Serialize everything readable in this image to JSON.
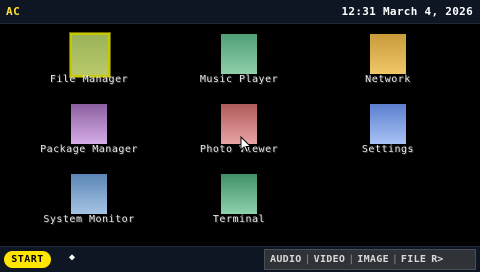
{
  "header": {
    "brand": "AC",
    "clock": "12:31 March 4, 2026"
  },
  "apps": [
    {
      "label": "File Manager",
      "icon": "file-manager-icon",
      "color_top": "#9bb35a",
      "color_bottom": "#b8c96a",
      "selected": true
    },
    {
      "label": "Music Player",
      "icon": "music-player-icon",
      "color_top": "#4f9f77",
      "color_bottom": "#8fd0aa"
    },
    {
      "label": "Network",
      "icon": "network-icon",
      "color_top": "#c99a3a",
      "color_bottom": "#f0c768"
    },
    {
      "label": "Package Manager",
      "icon": "package-manager-icon",
      "color_top": "#8a5fa0",
      "color_bottom": "#d6aee8"
    },
    {
      "label": "Photo Viewer",
      "icon": "photo-viewer-icon",
      "color_top": "#b05a5a",
      "color_bottom": "#e8a4a4"
    },
    {
      "label": "Settings",
      "icon": "settings-icon",
      "color_top": "#5c7fcf",
      "color_bottom": "#a9c2f4"
    },
    {
      "label": "System Monitor",
      "icon": "system-monitor-icon",
      "color_top": "#5b86b5",
      "color_bottom": "#a6c4e4"
    },
    {
      "label": "Terminal",
      "icon": "terminal-icon",
      "color_top": "#3f9068",
      "color_bottom": "#8fd2ad"
    }
  ],
  "footer": {
    "start_label": "START",
    "marker": "◆",
    "filters": [
      "AUDIO",
      "VIDEO",
      "IMAGE",
      "FILE"
    ],
    "more": "R>"
  },
  "colors": {
    "accent": "#ffe600",
    "selection_border": "#c8c800",
    "bar_bg": "#0d1622"
  }
}
